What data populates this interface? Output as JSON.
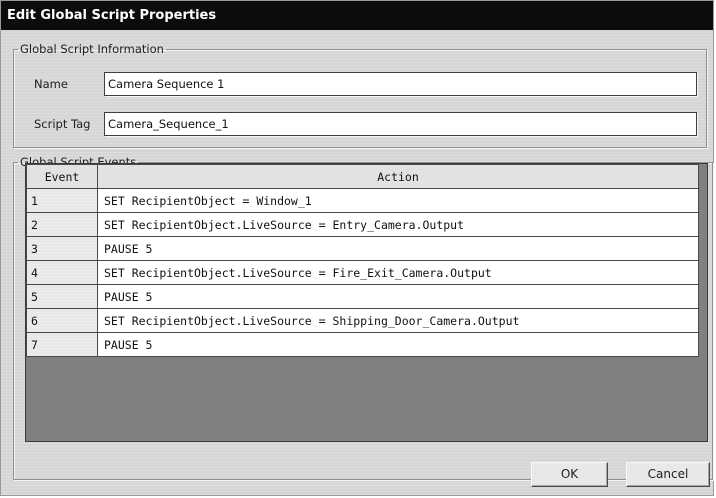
{
  "window": {
    "title": "Edit Global Script Properties"
  },
  "info_group": {
    "legend": "Global Script Information",
    "name_label": "Name",
    "name_value": "Camera Sequence 1",
    "tag_label": "Script Tag",
    "tag_value": "Camera_Sequence_1"
  },
  "events_group": {
    "legend": "Global Script Events",
    "columns": [
      "Event",
      "Action"
    ],
    "rows": [
      {
        "event": "1",
        "action": "SET RecipientObject = Window_1"
      },
      {
        "event": "2",
        "action": "SET RecipientObject.LiveSource = Entry_Camera.Output"
      },
      {
        "event": "3",
        "action": "PAUSE 5"
      },
      {
        "event": "4",
        "action": "SET RecipientObject.LiveSource = Fire_Exit_Camera.Output"
      },
      {
        "event": "5",
        "action": "PAUSE 5"
      },
      {
        "event": "6",
        "action": "SET RecipientObject.LiveSource = Shipping_Door_Camera.Output"
      },
      {
        "event": "7",
        "action": "PAUSE 5"
      }
    ]
  },
  "buttons": {
    "ok": "OK",
    "cancel": "Cancel"
  }
}
